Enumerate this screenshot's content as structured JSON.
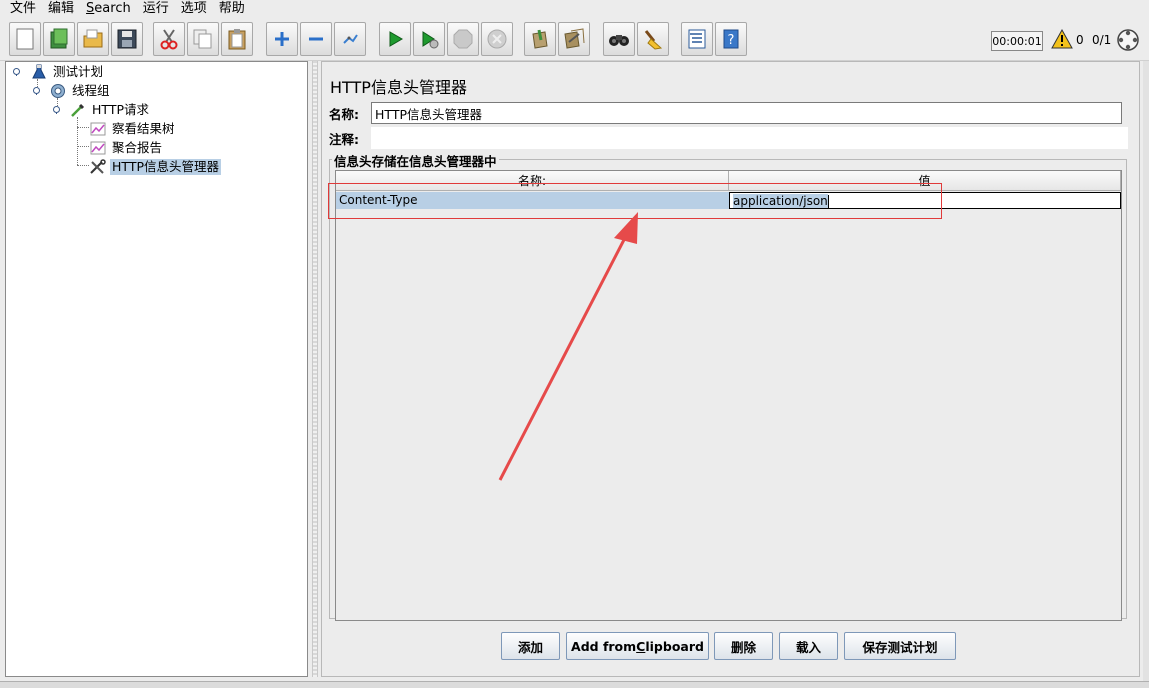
{
  "menu": {
    "file": "文件",
    "edit": "编辑",
    "search_prefix": "",
    "search_underlined": "S",
    "search_rest": "earch",
    "run": "运行",
    "options": "选项",
    "help": "帮助"
  },
  "toolbar": {
    "buttons": [
      "new-icon",
      "templates-icon",
      "open-icon",
      "save-icon",
      "cut-icon",
      "copy-icon",
      "paste-icon",
      "expand-icon",
      "collapse-icon",
      "toggle-icon",
      "start-icon",
      "start-no-pause-icon",
      "stop-icon",
      "shutdown-icon",
      "clear-icon",
      "clear-all-icon",
      "search-icon",
      "reset-search-icon",
      "function-helper-icon",
      "help-icon"
    ],
    "timer": "00:00:01",
    "warning_count": "0",
    "threads": "0/1"
  },
  "tree": {
    "test_plan": "测试计划",
    "thread_group": "线程组",
    "http_request": "HTTP请求",
    "results_tree": "察看结果树",
    "aggregate_report": "聚合报告",
    "header_manager": "HTTP信息头管理器"
  },
  "panel": {
    "title": "HTTP信息头管理器",
    "name_label": "名称:",
    "name_value": "HTTP信息头管理器",
    "comment_label": "注释:",
    "comment_value": "",
    "group_title": "信息头存储在信息头管理器中",
    "table": {
      "headers": [
        "名称:",
        "值"
      ],
      "rows": [
        {
          "name": "Content-Type",
          "value": "application/json"
        }
      ]
    }
  },
  "buttons": {
    "add": "添加",
    "clipboard_prefix": "Add from ",
    "clipboard_underlined": "C",
    "clipboard_rest": "lipboard",
    "delete": "删除",
    "load": "载入",
    "save_plan": "保存测试计划"
  },
  "colors": {
    "selection": "#b8cfe5",
    "annotation_red": "#e03a3a"
  }
}
